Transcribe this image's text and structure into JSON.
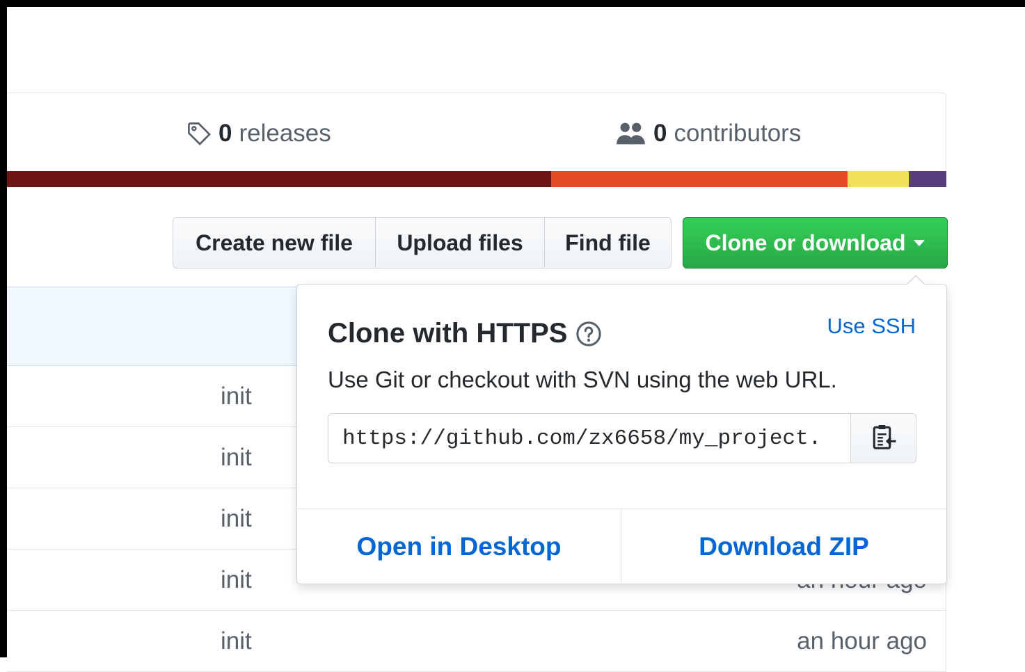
{
  "summary": {
    "releases": {
      "count": "0",
      "label": "releases",
      "icon": "tag-icon"
    },
    "contributors": {
      "count": "0",
      "label": "contributors",
      "icon": "people-icon"
    }
  },
  "language_bar": {
    "colors": [
      "#701516",
      "#e34c26",
      "#f1e05a",
      "#563d7c"
    ]
  },
  "toolbar": {
    "create_label": "Create new file",
    "upload_label": "Upload files",
    "find_label": "Find file",
    "clone_label": "Clone or download",
    "clone_color": "#28a745"
  },
  "file_rows": [
    {
      "message": "init",
      "age": ""
    },
    {
      "message": "init",
      "age": ""
    },
    {
      "message": "init",
      "age": ""
    },
    {
      "message": "init",
      "age": "an hour ago"
    },
    {
      "message": "init",
      "age": "an hour ago"
    }
  ],
  "clone_dropdown": {
    "title": "Clone with HTTPS",
    "help_icon": "question-icon",
    "use_ssh": "Use SSH",
    "description": "Use Git or checkout with SVN using the web URL.",
    "url": "https://github.com/zx6658/my_project.",
    "copy_icon": "clipboard-icon",
    "open_desktop": "Open in Desktop",
    "download_zip": "Download ZIP",
    "link_color": "#0366d6"
  }
}
